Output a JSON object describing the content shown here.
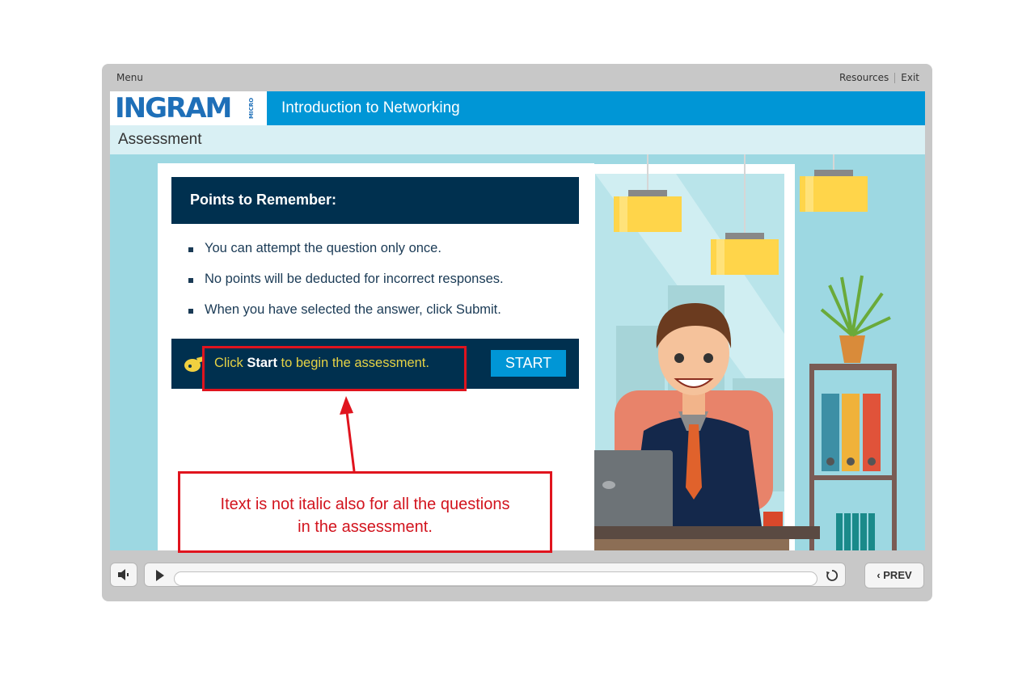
{
  "top_bar": {
    "menu": "Menu",
    "resources": "Resources",
    "exit": "Exit"
  },
  "header": {
    "logo": "INGRAM",
    "logo_sub": "MICRO",
    "course_title": "Introduction to Networking"
  },
  "page_title": "Assessment",
  "points": {
    "title": "Points to Remember:",
    "items": [
      "You can attempt the question only once.",
      "No points will be deducted for incorrect responses.",
      "When you have selected the answer, click Submit."
    ]
  },
  "cta": {
    "prefix": "Click ",
    "bold": "Start",
    "suffix": " to begin the assessment.",
    "button": "START"
  },
  "annotation": {
    "line1": "Itext is not italic also for all the questions",
    "line2": "in the assessment."
  },
  "controls": {
    "prev": "PREV"
  },
  "colors": {
    "brand_blue": "#0096d6",
    "navy": "#00304f",
    "cta_yellow": "#e5d245",
    "annotation_red": "#e0141e"
  }
}
